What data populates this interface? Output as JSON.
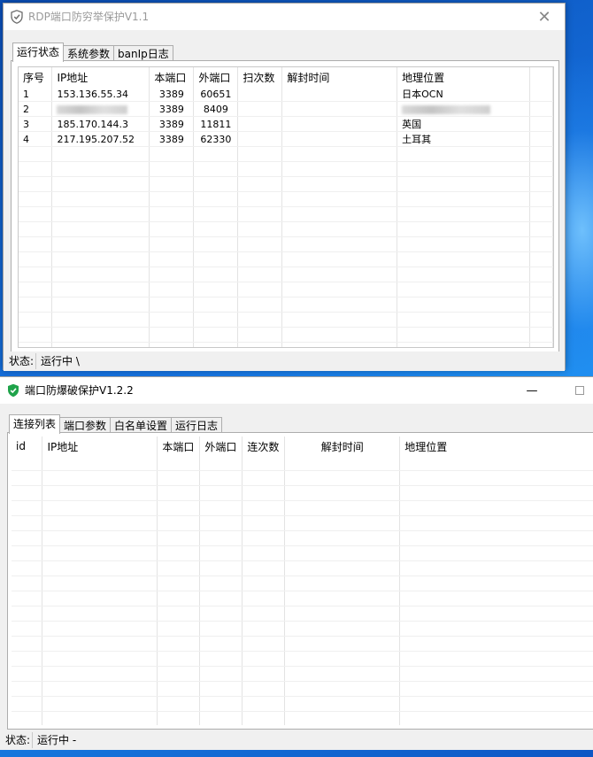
{
  "colors": {
    "accent_green": "#1fa34a",
    "desktop_blue": "#0b5fc6"
  },
  "window1": {
    "title": "RDP端口防穷举保护V1.1",
    "close_glyph": "✕",
    "tabs": [
      "运行状态",
      "系统参数",
      "banIp日志"
    ],
    "active_tab": 0,
    "columns": [
      "序号",
      "IP地址",
      "本端口",
      "外端口",
      "扫次数",
      "解封时间",
      "地理位置"
    ],
    "rows": [
      {
        "no": "1",
        "ip": "153.136.55.34",
        "local_port": "3389",
        "remote_port": "60651",
        "count": "",
        "unban": "",
        "geo": "日本OCN"
      },
      {
        "no": "2",
        "ip": "",
        "local_port": "3389",
        "remote_port": "8409",
        "count": "",
        "unban": "",
        "geo": ""
      },
      {
        "no": "3",
        "ip": "185.170.144.3",
        "local_port": "3389",
        "remote_port": "11811",
        "count": "",
        "unban": "",
        "geo": "英国"
      },
      {
        "no": "4",
        "ip": "217.195.207.52",
        "local_port": "3389",
        "remote_port": "62330",
        "count": "",
        "unban": "",
        "geo": "土耳其"
      }
    ],
    "status_label": "状态:",
    "status_value": "运行中 \\"
  },
  "window2": {
    "title": "端口防爆破保护V1.2.2",
    "minimize_glyph": "—",
    "tabs": [
      "连接列表",
      "端口参数",
      "白名单设置",
      "运行日志"
    ],
    "active_tab": 0,
    "columns": [
      "id",
      "IP地址",
      "本端口",
      "外端口",
      "连次数",
      "解封时间",
      "地理位置"
    ],
    "status_label": "状态:",
    "status_value": "运行中 -"
  }
}
